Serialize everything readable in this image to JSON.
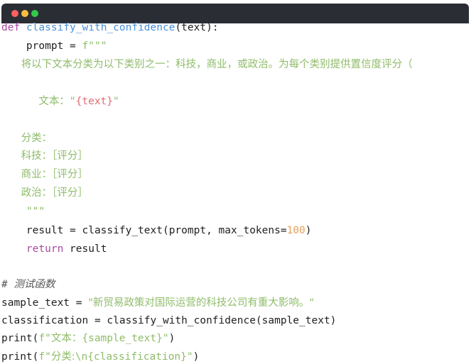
{
  "window": {
    "title_buttons": [
      "close",
      "minimize",
      "maximize"
    ],
    "colors": {
      "titlebar": "#2b2d35",
      "close": "#fc615d",
      "minimize": "#fdbc40",
      "maximize": "#34c84a"
    }
  },
  "code": {
    "line1": {
      "kw": "def",
      "fn": "classify_with_confidence",
      "rest": "(text):"
    },
    "line2": {
      "indent": "    ",
      "plain": "prompt = ",
      "str": "f\"\"\""
    },
    "line3": {
      "text": "      将以下文本分类为以下类别之一：科技，商业，或政治。为每个类别提供置信度评分（"
    },
    "line5": {
      "indent": "      ",
      "label": "文本：",
      "q1": "\"",
      "var": "{text}",
      "q2": "\""
    },
    "line7": {
      "text": "      分类："
    },
    "line8": {
      "text": "      科技：［评分］"
    },
    "line9": {
      "text": "      商业：［评分］"
    },
    "line10": {
      "text": "      政治：［评分］"
    },
    "line11": {
      "text": "    \"\"\""
    },
    "line12": {
      "indent": "    ",
      "plain": "result = classify_text(prompt, max_tokens=",
      "num": "100",
      "end": ")"
    },
    "line13": {
      "indent": "    ",
      "kw": "return",
      "rest": " result"
    },
    "line15": {
      "hash": "# ",
      "comment": "测试函数"
    },
    "line16": {
      "plain": "sample_text = ",
      "str": "\"新贸易政策对国际运营的科技公司有重大影响。\""
    },
    "line17": {
      "plain": "classification = classify_with_confidence(sample_text)"
    },
    "line18": {
      "plain": "print(",
      "f": "f",
      "q1": "\"",
      "label": "文本：",
      "var": "{sample_text}",
      "q2": "\"",
      "end": ")"
    },
    "line19": {
      "plain": "print(",
      "f": "f",
      "q1": "\"",
      "label": "分类:",
      "esc": "\\n",
      "var": "{classification}",
      "q2": "\"",
      "end": ")"
    }
  }
}
